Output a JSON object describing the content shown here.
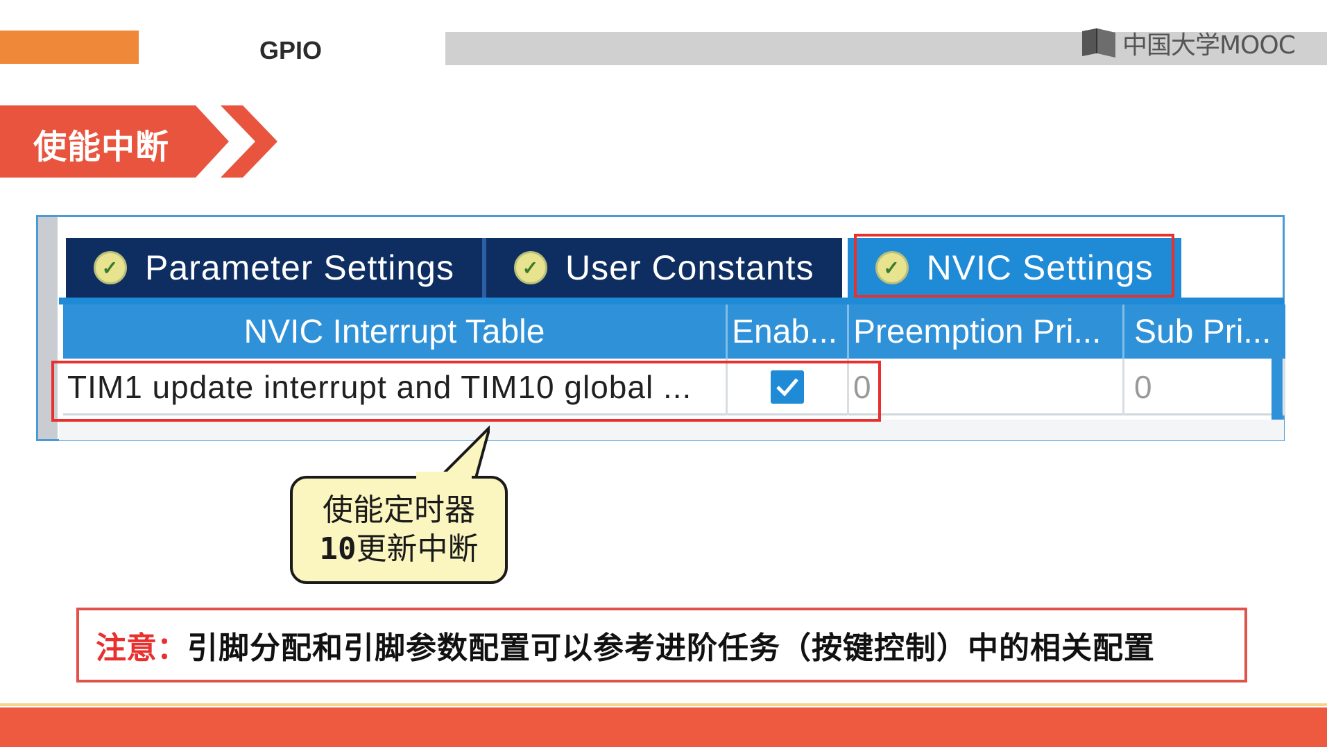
{
  "header": {
    "title": "GPIO",
    "logo_text": "中国大学MOOC",
    "logo_icon": "book-icon",
    "accent_color": "#f0883a"
  },
  "section": {
    "title": "使能中断",
    "color": "#e8543d"
  },
  "config_panel": {
    "tabs": [
      {
        "label": "Parameter Settings",
        "icon": "check-circle-icon",
        "active": false
      },
      {
        "label": "User Constants",
        "icon": "check-circle-icon",
        "active": false
      },
      {
        "label": "NVIC Settings",
        "icon": "check-circle-icon",
        "active": true
      }
    ],
    "table": {
      "headers": [
        "NVIC Interrupt Table",
        "Enab...",
        "Preemption Pri...",
        "Sub Pri..."
      ],
      "rows": [
        {
          "name": "TIM1 update interrupt and TIM10 global ...",
          "enabled": true,
          "preemption_priority": "0",
          "sub_priority": "0"
        }
      ]
    },
    "highlight_color": "#e8302e"
  },
  "callout": {
    "line1": "使能定时器",
    "line2_number": "10",
    "line2_text": "更新中断"
  },
  "note": {
    "label": "注意：",
    "text": "引脚分配和引脚参数配置可以参考进阶任务（按键控制）中的相关配置"
  }
}
